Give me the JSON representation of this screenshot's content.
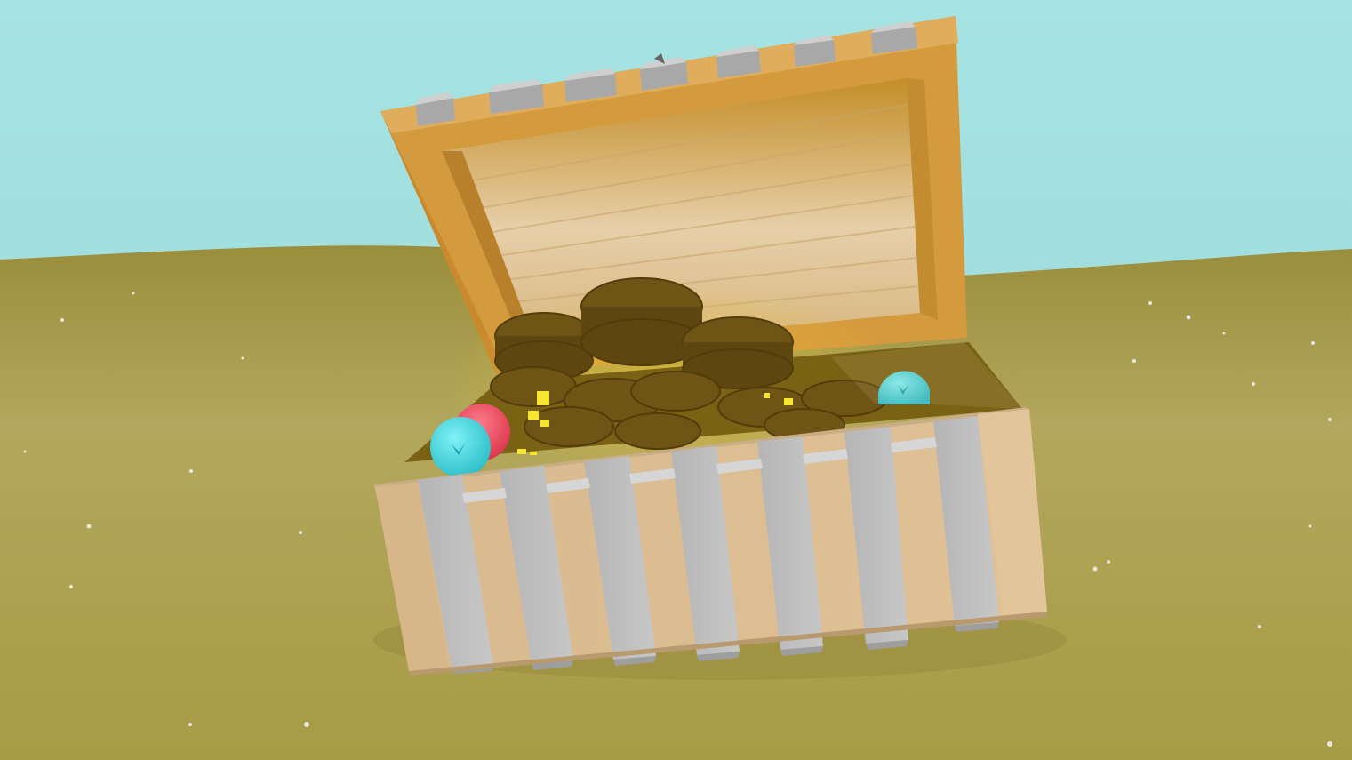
{
  "scene": {
    "subject": "open-treasure-chest",
    "colors": {
      "sky_top": "#a4e2e2",
      "sky_bottom": "#9fdcdc",
      "sand_light": "#b3a85e",
      "sand_dark": "#8f8232",
      "wood_outer": "#d9b07a",
      "wood_lid_inner_light": "#e6cfaa",
      "wood_lid_inner_dark": "#c48f2f",
      "metal_band": "#bdbdbd",
      "coin_dark": "#6e5212",
      "gem_cyan": "#3fd2dc",
      "gem_red": "#e8455a",
      "sparkle": "#f6e63a"
    },
    "objects": [
      "chest-lid",
      "chest-body",
      "coin-pile",
      "cyan-gem",
      "red-gem",
      "sparkle"
    ]
  }
}
